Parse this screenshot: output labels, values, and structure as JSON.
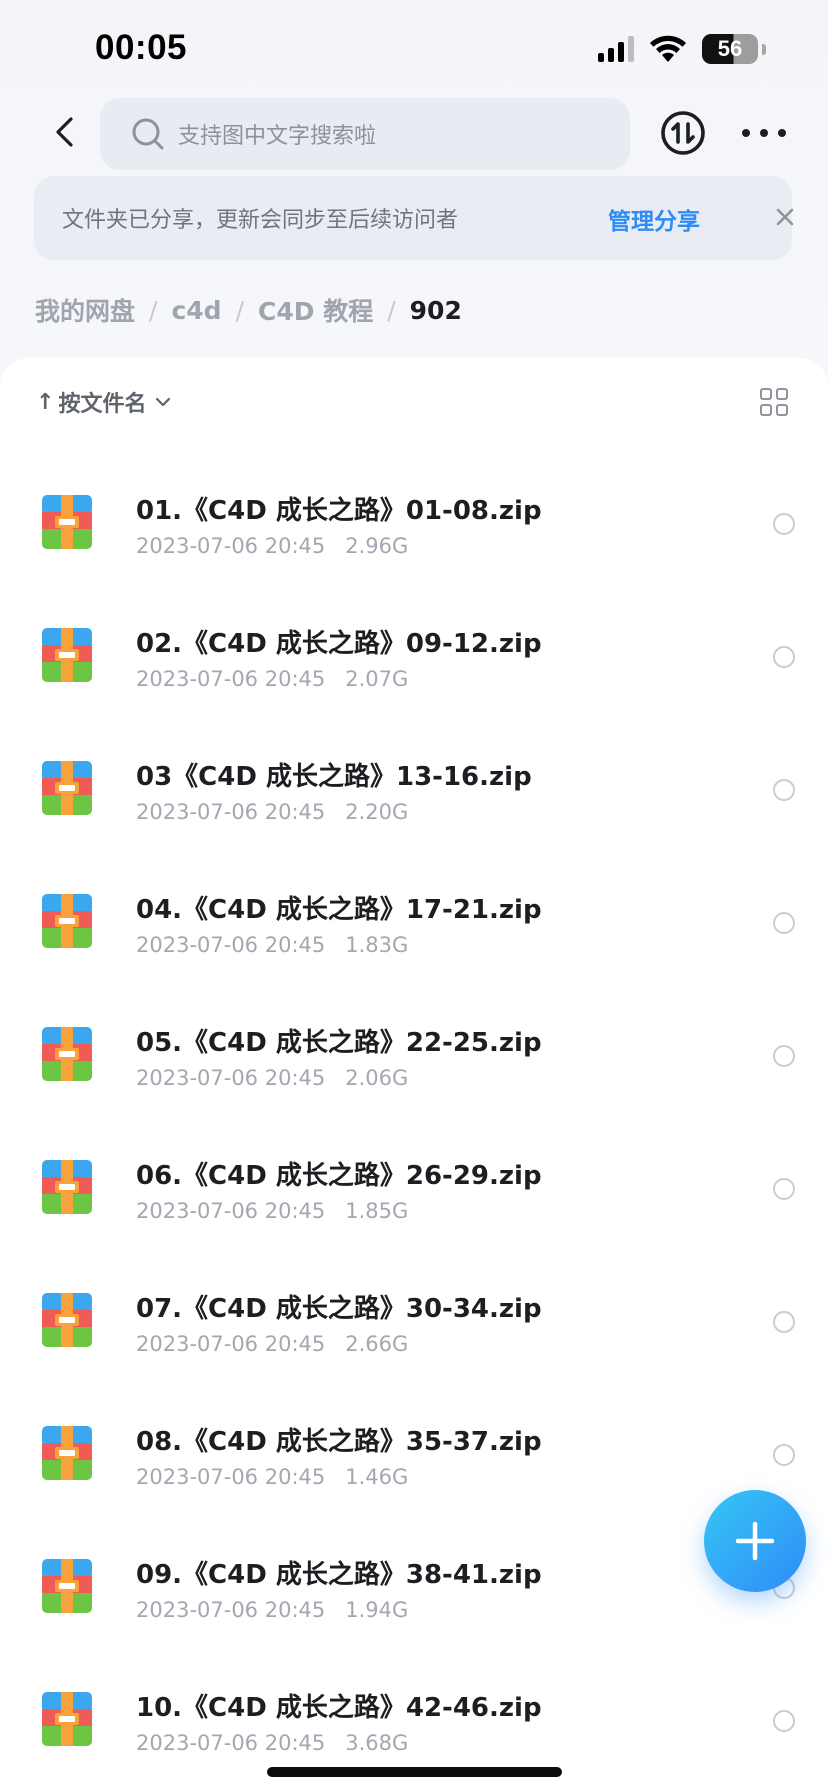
{
  "status_bar": {
    "time": "00:05",
    "battery": "56"
  },
  "header": {
    "search_placeholder": "支持图中文字搜索啦"
  },
  "share_banner": {
    "text": "文件夹已分享，更新会同步至后续访问者",
    "manage_label": "管理分享"
  },
  "breadcrumb": [
    "我的网盘",
    "c4d",
    "C4D 教程",
    "902"
  ],
  "sort": {
    "arrow": "↑",
    "label": "按文件名"
  },
  "files": [
    {
      "name": "01.《C4D 成长之路》01-08.zip",
      "date": "2023-07-06 20:45",
      "size": "2.96G"
    },
    {
      "name": "02.《C4D 成长之路》09-12.zip",
      "date": "2023-07-06 20:45",
      "size": "2.07G"
    },
    {
      "name": "03《C4D 成长之路》13-16.zip",
      "date": "2023-07-06 20:45",
      "size": "2.20G"
    },
    {
      "name": "04.《C4D 成长之路》17-21.zip",
      "date": "2023-07-06 20:45",
      "size": "1.83G"
    },
    {
      "name": "05.《C4D 成长之路》22-25.zip",
      "date": "2023-07-06 20:45",
      "size": "2.06G"
    },
    {
      "name": "06.《C4D 成长之路》26-29.zip",
      "date": "2023-07-06 20:45",
      "size": "1.85G"
    },
    {
      "name": "07.《C4D 成长之路》30-34.zip",
      "date": "2023-07-06 20:45",
      "size": "2.66G"
    },
    {
      "name": "08.《C4D 成长之路》35-37.zip",
      "date": "2023-07-06 20:45",
      "size": "1.46G"
    },
    {
      "name": "09.《C4D 成长之路》38-41.zip",
      "date": "2023-07-06 20:45",
      "size": "1.94G"
    },
    {
      "name": "10.《C4D 成长之路》42-46.zip",
      "date": "2023-07-06 20:45",
      "size": "3.68G"
    }
  ],
  "colors": {
    "accent": "#2f8cf7",
    "fab_start": "#35c6f5"
  },
  "icons": {
    "file": "zip-archive-icon",
    "fab": "plus-icon"
  }
}
